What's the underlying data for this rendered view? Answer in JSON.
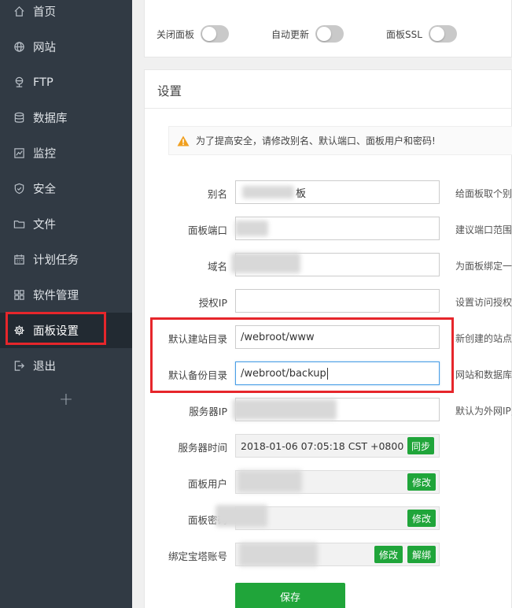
{
  "sidebar": {
    "items": [
      {
        "label": "首页",
        "icon": "home-icon"
      },
      {
        "label": "网站",
        "icon": "globe-icon"
      },
      {
        "label": "FTP",
        "icon": "ftp-icon"
      },
      {
        "label": "数据库",
        "icon": "database-icon"
      },
      {
        "label": "监控",
        "icon": "monitor-icon"
      },
      {
        "label": "安全",
        "icon": "shield-icon"
      },
      {
        "label": "文件",
        "icon": "folder-icon"
      },
      {
        "label": "计划任务",
        "icon": "calendar-icon"
      },
      {
        "label": "软件管理",
        "icon": "apps-icon"
      },
      {
        "label": "面板设置",
        "icon": "gear-icon"
      },
      {
        "label": "退出",
        "icon": "logout-icon"
      }
    ],
    "add_label": "+"
  },
  "toggles": [
    {
      "label": "关闭面板",
      "on": false
    },
    {
      "label": "自动更新",
      "on": false
    },
    {
      "label": "面板SSL",
      "on": false
    }
  ],
  "settings": {
    "title": "设置",
    "warning": "为了提高安全，请修改别名、默认端口、面板用户和密码!",
    "rows": {
      "alias": {
        "label": "别名",
        "value": "板",
        "hint": "给面板取个别"
      },
      "port": {
        "label": "面板端口",
        "value": "",
        "hint": "建议端口范围"
      },
      "domain": {
        "label": "域名",
        "value": "",
        "hint": "为面板绑定一"
      },
      "auth_ip": {
        "label": "授权IP",
        "value": "",
        "hint": "设置访问授权"
      },
      "site_dir": {
        "label": "默认建站目录",
        "value": "/webroot/www",
        "hint": "新创建的站点"
      },
      "backup_dir": {
        "label": "默认备份目录",
        "value": "/webroot/backup",
        "hint": "网站和数据库"
      },
      "server_ip": {
        "label": "服务器IP",
        "value": "",
        "hint": "默认为外网IP,"
      },
      "server_time": {
        "label": "服务器时间",
        "value": "2018-01-06 07:05:18 CST +0800",
        "button": "同步"
      },
      "panel_user": {
        "label": "面板用户",
        "button": "修改"
      },
      "panel_pass": {
        "label": "面板密码",
        "button": "修改"
      },
      "bt_account": {
        "label": "绑定宝塔账号",
        "button_edit": "修改",
        "button_unbind": "解绑"
      }
    },
    "save_label": "保存"
  },
  "colors": {
    "sidebar_bg": "#313a44",
    "active_bg": "#222a32",
    "accent_green": "#20a53a",
    "highlight_red": "#e6262b"
  }
}
